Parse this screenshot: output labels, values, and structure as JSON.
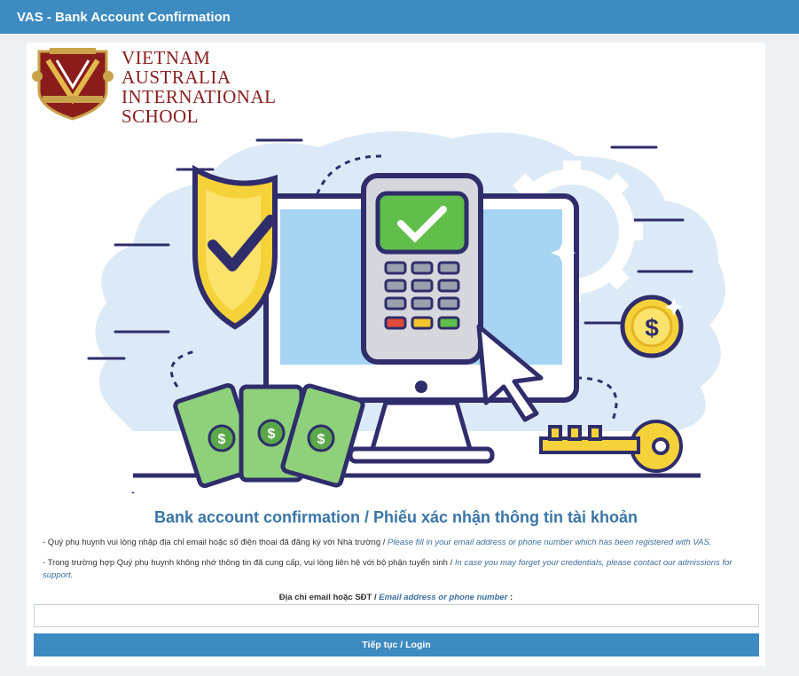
{
  "window": {
    "title": "VAS - Bank Account Confirmation"
  },
  "logo": {
    "line1": "VIETNAM",
    "line2": "AUSTRALIA",
    "line3": "INTERNATIONAL",
    "line4": "SCHOOL",
    "crest_text": "VIETNAM AUSTRALIA INTERNATIONAL SCHOOL"
  },
  "hero": {
    "illustration": "bank-payment-illustration"
  },
  "form": {
    "heading": "Bank account confirmation / Phiếu xác nhận thông tin tài khoản",
    "note1_vi": "- Quý phụ huynh vui lòng nhập địa chỉ email hoặc số điện thoại đã đăng ký với Nhà trường / ",
    "note1_en": "Please fill in your email address or phone number which has been registered with VAS.",
    "note2_vi": "- Trong trường hợp Quý phụ huynh không nhớ thông tin đã cung cấp, vui lòng liên hệ với bộ phận tuyển sinh / ",
    "note2_en": "In case you may forget your credentials, please contact our admissions for support.",
    "label_vi": "Địa chỉ email hoặc SĐT / ",
    "label_en": "Email address or phone number",
    "label_suffix": " :",
    "input_value": "",
    "button_label": "Tiếp tục / Login"
  },
  "colors": {
    "titlebar": "#3d8bc0",
    "heading": "#3a75a6",
    "brand_red": "#8a1c1c"
  }
}
